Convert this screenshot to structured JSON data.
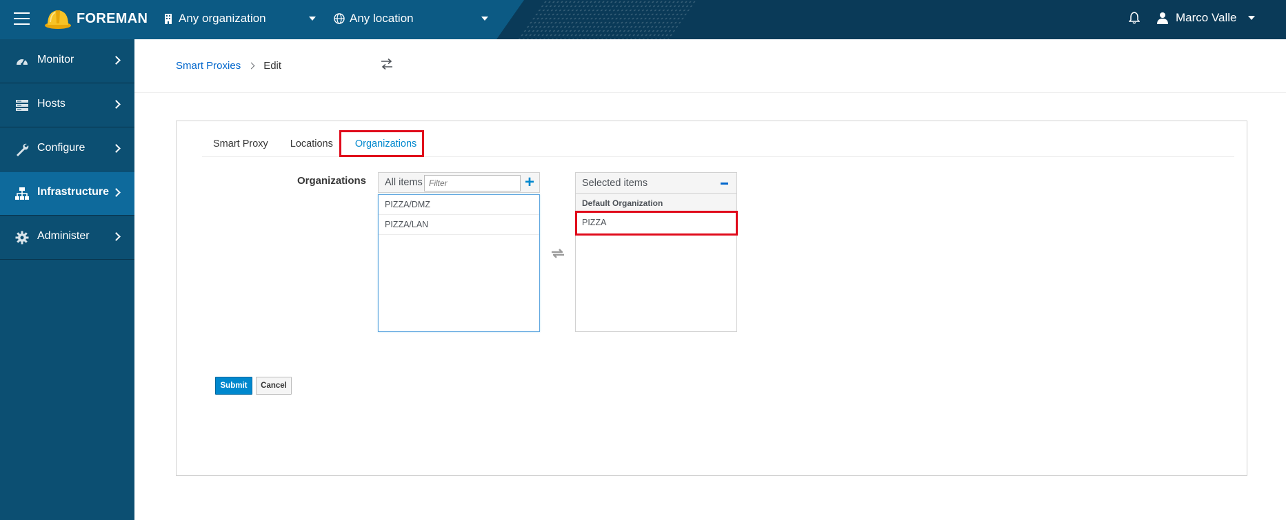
{
  "topbar": {
    "brand": "FOREMAN",
    "organization": "Any organization",
    "location": "Any location",
    "user": "Marco Valle"
  },
  "sidebar": {
    "items": [
      {
        "label": "Monitor",
        "icon": "dashboard-icon"
      },
      {
        "label": "Hosts",
        "icon": "server-icon"
      },
      {
        "label": "Configure",
        "icon": "wrench-icon"
      },
      {
        "label": "Infrastructure",
        "icon": "network-icon",
        "active": true
      },
      {
        "label": "Administer",
        "icon": "gear-icon"
      }
    ]
  },
  "breadcrumb": {
    "parent": "Smart Proxies",
    "current": "Edit"
  },
  "tabs": [
    "Smart Proxy",
    "Locations",
    "Organizations"
  ],
  "active_tab": "Organizations",
  "form": {
    "field_label": "Organizations",
    "all_items_label": "All items",
    "filter_placeholder": "Filter",
    "available": [
      "PIZZA/DMZ",
      "PIZZA/LAN"
    ],
    "selected_label": "Selected items",
    "selected_group": "Default Organization",
    "selected": [
      "PIZZA"
    ]
  },
  "buttons": {
    "submit": "Submit",
    "cancel": "Cancel"
  },
  "colors": {
    "topbar": "#0c5a84",
    "sidebar": "#0c4f72",
    "accent": "#0088ce",
    "highlight": "#e00a1b"
  }
}
